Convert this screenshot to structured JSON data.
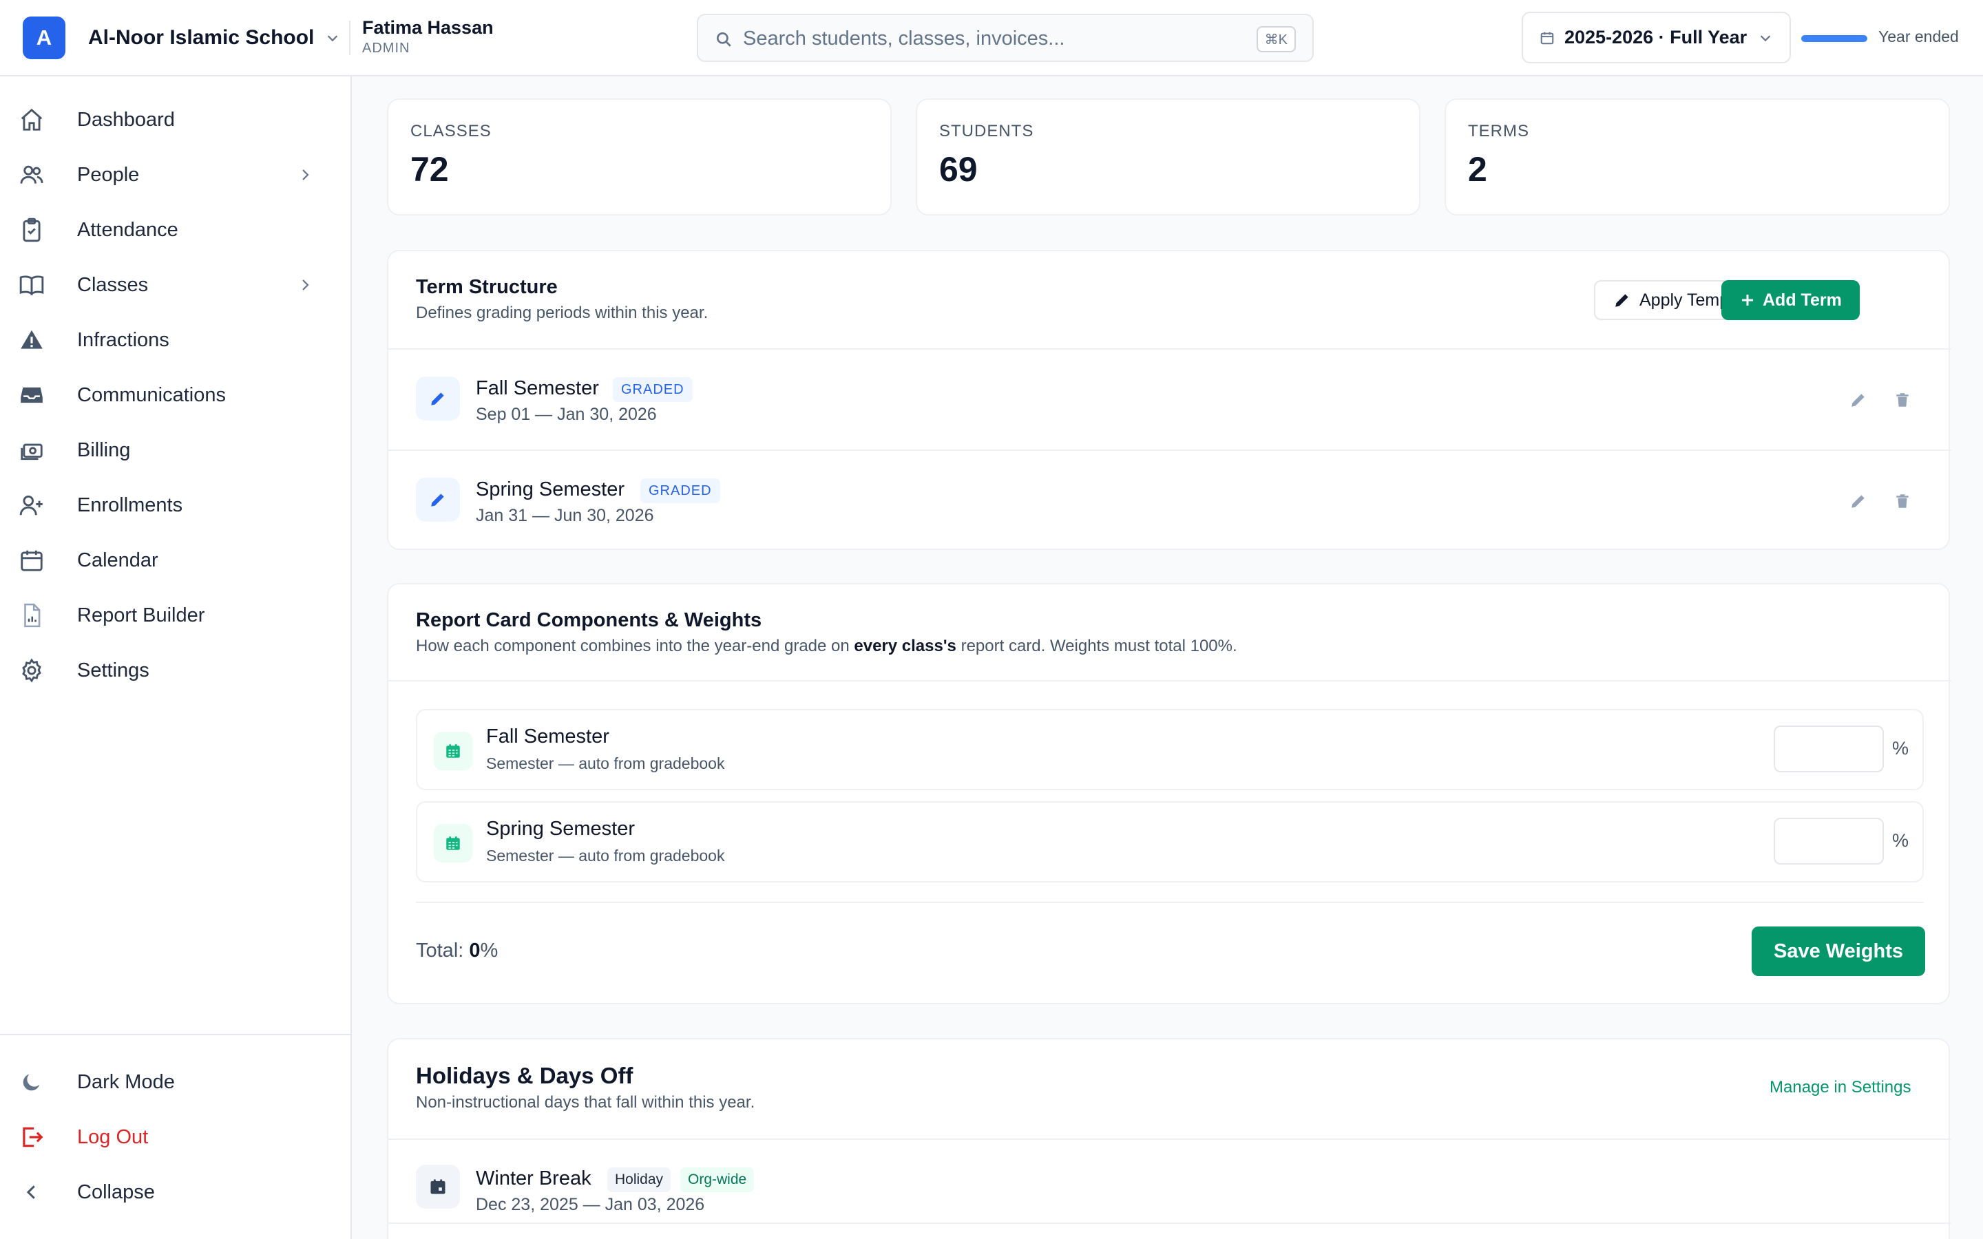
{
  "header": {
    "logo_letter": "A",
    "school_name": "Al-Noor Islamic School",
    "user_name": "Fatima Hassan",
    "user_role": "ADMIN",
    "search_placeholder": "Search students, classes, invoices...",
    "search_shortcut": "⌘K",
    "year_selector": "2025-2026 · Full Year",
    "year_status": "Year ended",
    "year_progress": 1.0
  },
  "sidebar": {
    "items": [
      {
        "label": "Dashboard",
        "icon": "home-icon"
      },
      {
        "label": "People",
        "icon": "users-icon",
        "has_submenu": true
      },
      {
        "label": "Attendance",
        "icon": "clipboard-check-icon"
      },
      {
        "label": "Classes",
        "icon": "book-open-icon",
        "has_submenu": true
      },
      {
        "label": "Infractions",
        "icon": "warning-icon"
      },
      {
        "label": "Communications",
        "icon": "inbox-icon"
      },
      {
        "label": "Billing",
        "icon": "cash-icon"
      },
      {
        "label": "Enrollments",
        "icon": "user-plus-icon"
      },
      {
        "label": "Calendar",
        "icon": "calendar-icon"
      },
      {
        "label": "Report Builder",
        "icon": "document-chart-icon"
      },
      {
        "label": "Settings",
        "icon": "gear-icon"
      }
    ],
    "bottom": {
      "dark_mode": "Dark Mode",
      "logout": "Log Out",
      "collapse": "Collapse"
    }
  },
  "stats": [
    {
      "label": "CLASSES",
      "value": "72"
    },
    {
      "label": "STUDENTS",
      "value": "69"
    },
    {
      "label": "TERMS",
      "value": "2"
    }
  ],
  "term_structure": {
    "title": "Term Structure",
    "subtitle": "Defines grading periods within this year.",
    "apply_template": "Apply Template",
    "add_term": "Add Term",
    "terms": [
      {
        "name": "Fall Semester",
        "badge": "GRADED",
        "dates": "Sep 01 — Jan 30, 2026"
      },
      {
        "name": "Spring Semester",
        "badge": "GRADED",
        "dates": "Jan 31 — Jun 30, 2026"
      }
    ]
  },
  "weights": {
    "title": "Report Card Components & Weights",
    "subtitle_pre": "How each component combines into the year-end grade on ",
    "subtitle_bold": "every class's",
    "subtitle_post": " report card. Weights must total 100%.",
    "components": [
      {
        "name": "Fall Semester",
        "source": "Semester — auto from gradebook",
        "value": "",
        "unit": "%"
      },
      {
        "name": "Spring Semester",
        "source": "Semester — auto from gradebook",
        "value": "",
        "unit": "%"
      }
    ],
    "total_label": "Total: ",
    "total_value": "0",
    "total_unit": "%",
    "save_label": "Save Weights"
  },
  "holidays": {
    "title": "Holidays & Days Off",
    "subtitle": "Non-instructional days that fall within this year.",
    "manage_link": "Manage in Settings",
    "items": [
      {
        "name": "Winter Break",
        "type": "Holiday",
        "scope": "Org-wide",
        "dates": "Dec 23, 2025 — Jan 03, 2026"
      }
    ]
  },
  "colors": {
    "primary_blue": "#2563eb",
    "accent_green": "#059669",
    "danger_red": "#dc2626"
  }
}
